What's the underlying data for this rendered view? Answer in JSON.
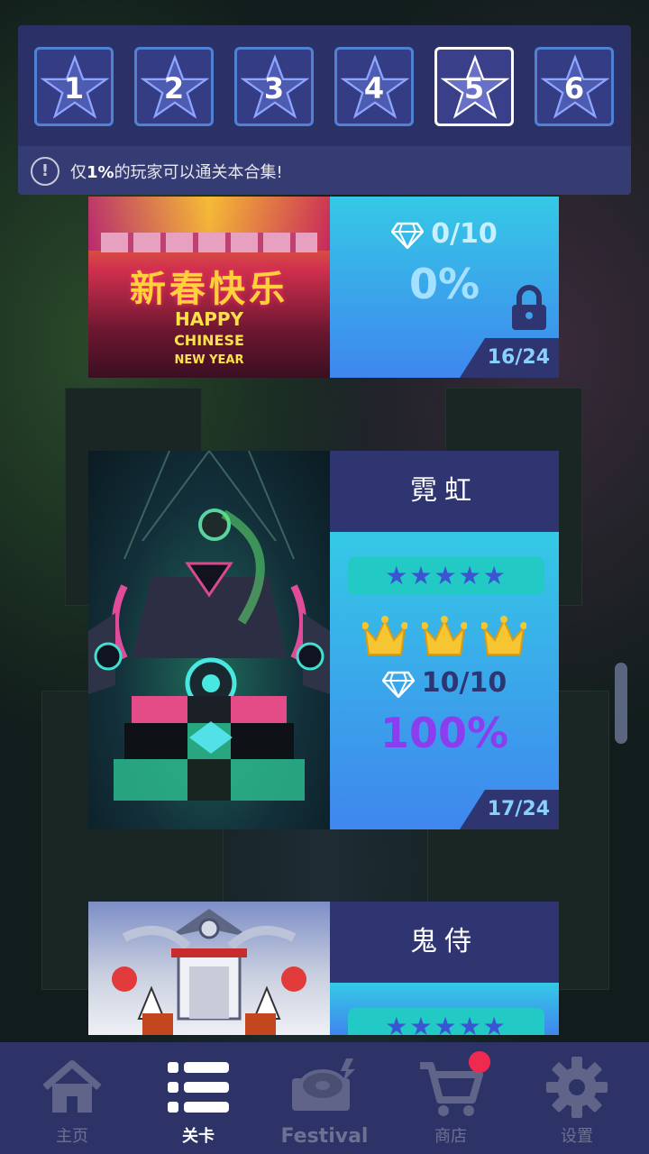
{
  "tabs": [
    {
      "label": "1",
      "active": false
    },
    {
      "label": "2",
      "active": false
    },
    {
      "label": "3",
      "active": false
    },
    {
      "label": "4",
      "active": false
    },
    {
      "label": "5",
      "active": true
    },
    {
      "label": "6",
      "active": false
    }
  ],
  "notice": {
    "prefix": "仅",
    "highlight": "1%",
    "suffix": "的玩家可以通关本合集!"
  },
  "levels": [
    {
      "art_text": "新春快乐",
      "art_sub1": "HAPPY",
      "art_sub2": "CHINESE",
      "art_sub3": "NEW YEAR",
      "gems": "0/10",
      "percent": "0%",
      "locked": true,
      "progress": "16/24"
    },
    {
      "title": "霓虹",
      "stars": "★★★★★",
      "crowns": 3,
      "gems": "10/10",
      "percent": "100%",
      "progress": "17/24"
    },
    {
      "title": "鬼侍",
      "stars": "★★★★★"
    }
  ],
  "nav": [
    {
      "label": "主页",
      "icon": "home-icon"
    },
    {
      "label": "关卡",
      "icon": "list-icon",
      "active": true
    },
    {
      "label": "Festival",
      "icon": "vinyl-icon"
    },
    {
      "label": "商店",
      "icon": "cart-icon",
      "badge": true
    },
    {
      "label": "设置",
      "icon": "gear-icon"
    }
  ],
  "colors": {
    "panel": "#2b3166",
    "tab_border": "#4f82d4",
    "accent_cyan": "#35c9e6",
    "percent_purple": "#8a3ef0",
    "badge_red": "#ee2b4f"
  }
}
